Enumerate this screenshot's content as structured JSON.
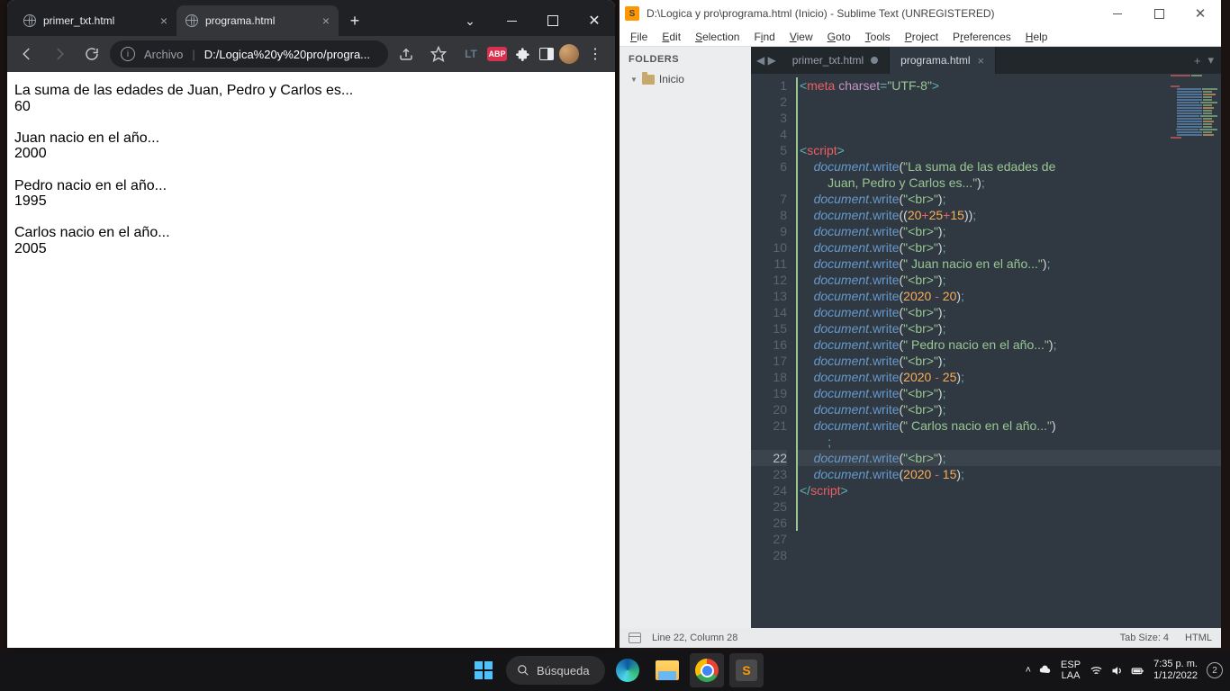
{
  "chrome": {
    "tabs": [
      {
        "label": "primer_txt.html",
        "active": false
      },
      {
        "label": "programa.html",
        "active": true
      }
    ],
    "omnibox": {
      "prefix": "Archivo",
      "path": "D:/Logica%20y%20pro/progra..."
    },
    "page": {
      "l1": "La suma de las edades de Juan, Pedro y Carlos es...",
      "l2": "60",
      "l3": " Juan nacio en el año...",
      "l4": "2000",
      "l5": " Pedro nacio en el año...",
      "l6": "1995",
      "l7": " Carlos nacio en el año...",
      "l8": "2005"
    }
  },
  "sublime": {
    "title": "D:\\Logica y pro\\programa.html (Inicio) - Sublime Text (UNREGISTERED)",
    "menus": {
      "file": "File",
      "edit": "Edit",
      "selection": "Selection",
      "find": "Find",
      "view": "View",
      "goto": "Goto",
      "tools": "Tools",
      "project": "Project",
      "preferences": "Preferences",
      "help": "Help"
    },
    "sidebar": {
      "header": "FOLDERS",
      "root": "Inicio"
    },
    "editor_tabs": [
      {
        "label": "primer_txt.html",
        "modified": true,
        "active": false
      },
      {
        "label": "programa.html",
        "modified": false,
        "active": true
      }
    ],
    "code": {
      "l1": {
        "a": "<",
        "b": "meta ",
        "c": "charset",
        "d": "=",
        "e": "\"UTF-8\"",
        "f": ">"
      },
      "l5": {
        "a": "<",
        "b": "script",
        "c": ">"
      },
      "dw": {
        "doc": "document",
        "dot": ".",
        "write": "write",
        "op": "(",
        "cp": ")",
        "semi": ";"
      },
      "s6": "\"La suma de las edades de ",
      "s6b": "Juan, Pedro y Carlos es...\"",
      "br": "\"<br>\"",
      "s8a": "((",
      "s8b": "20",
      "s8c": "+",
      "s8d": "25",
      "s8e": "+",
      "s8f": "15",
      "s8g": "))",
      "s11": "\" Juan nacio en el año...\"",
      "s13a": "2020",
      "s13b": " - ",
      "s13c": "20",
      "s16": "\" Pedro nacio en el año...\"",
      "s18c": "25",
      "s21": "\" Carlos nacio en el año...\"",
      "s23c": "15",
      "l24": {
        "a": "</",
        "b": "script",
        "c": ">"
      }
    },
    "status": {
      "pos": "Line 22, Column 28",
      "tabsize": "Tab Size: 4",
      "syntax": "HTML"
    }
  },
  "taskbar": {
    "search": "Búsqueda",
    "lang1": "ESP",
    "lang2": "LAA",
    "time": "7:35 p. m.",
    "date": "1/12/2022",
    "notif": "2"
  }
}
